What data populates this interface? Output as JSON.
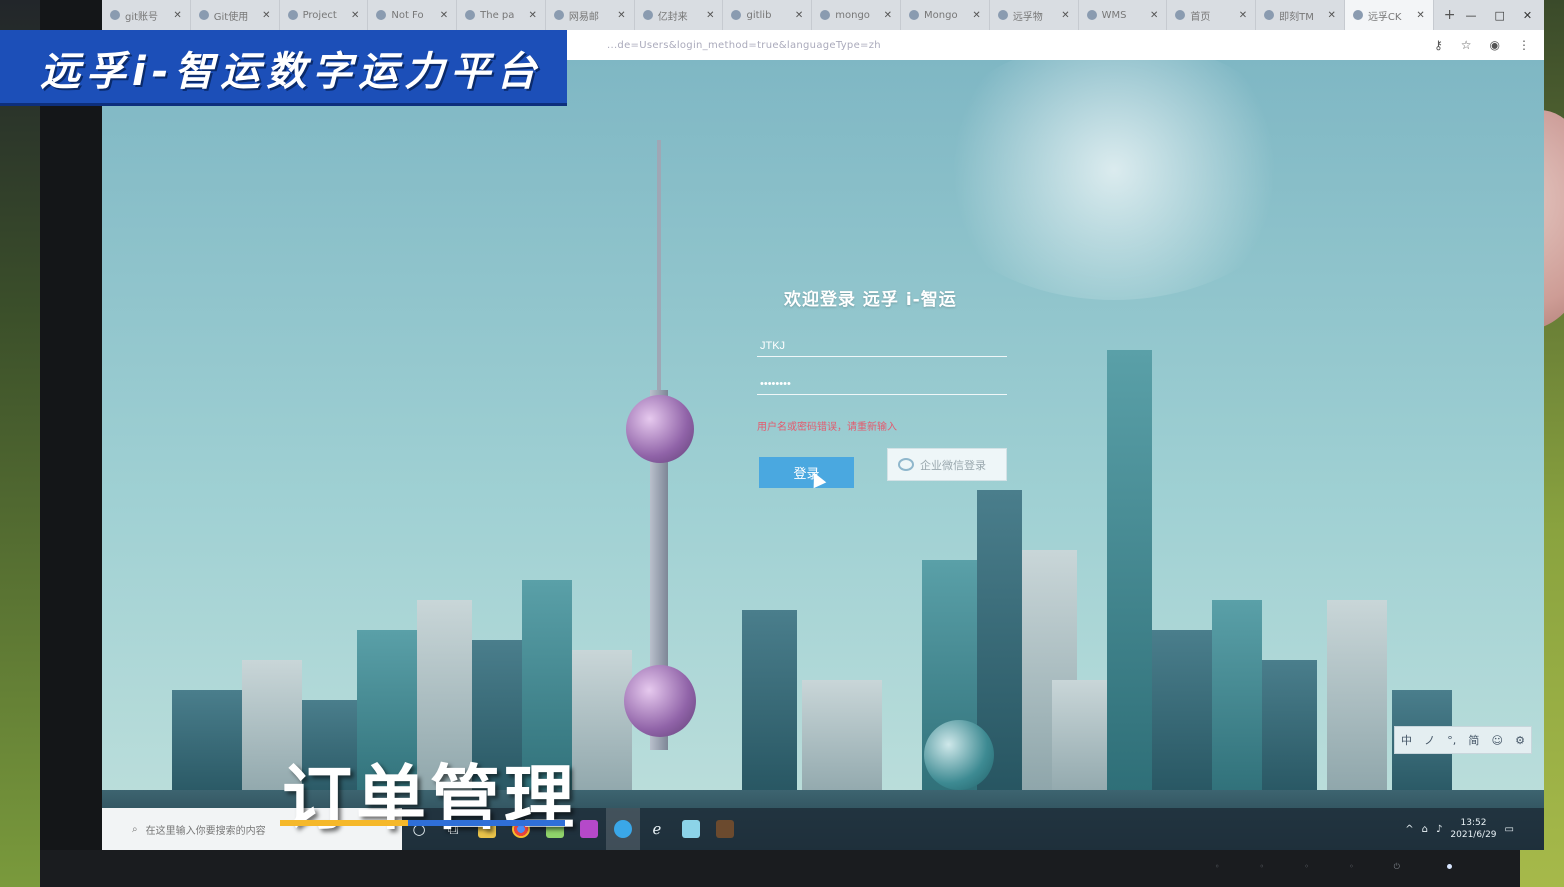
{
  "overlay": {
    "banner_title": "远孚i-智运数字运力平台",
    "caption": "订单管理"
  },
  "browser": {
    "tabs": [
      {
        "label": "git账号"
      },
      {
        "label": "Git使用"
      },
      {
        "label": "Project"
      },
      {
        "label": "Not Fo"
      },
      {
        "label": "The pa"
      },
      {
        "label": "网易邮"
      },
      {
        "label": "亿封来"
      },
      {
        "label": "gitlib"
      },
      {
        "label": "mongo"
      },
      {
        "label": "Mongo"
      },
      {
        "label": "远孚物"
      },
      {
        "label": "WMS"
      },
      {
        "label": "首页"
      },
      {
        "label": "即刻TM"
      },
      {
        "label": "远孚CK"
      }
    ],
    "new_tab_label": "+",
    "url": "...de=Users&login_method=true&languageType=zh"
  },
  "login": {
    "title": "欢迎登录 远孚 i-智运",
    "username_value": "JTKJ",
    "password_value": "••••••••",
    "error_text": "用户名或密码错误，请重新输入",
    "login_button": "登录",
    "wechat_button": "企业微信登录"
  },
  "taskbar": {
    "search_placeholder": "在这里输入你要搜索的内容",
    "ime": [
      "中",
      "ノ",
      "°,",
      "简",
      "☺",
      "⚙"
    ],
    "time": "13:52",
    "date": "2021/6/29"
  },
  "colors": {
    "banner_bg": "#1c4fb8",
    "login_button_bg": "#4aa8e0",
    "error_text": "#e35b6e",
    "caption_bar_gold": "#f5b82a",
    "caption_bar_blue": "#2f6fd8"
  }
}
